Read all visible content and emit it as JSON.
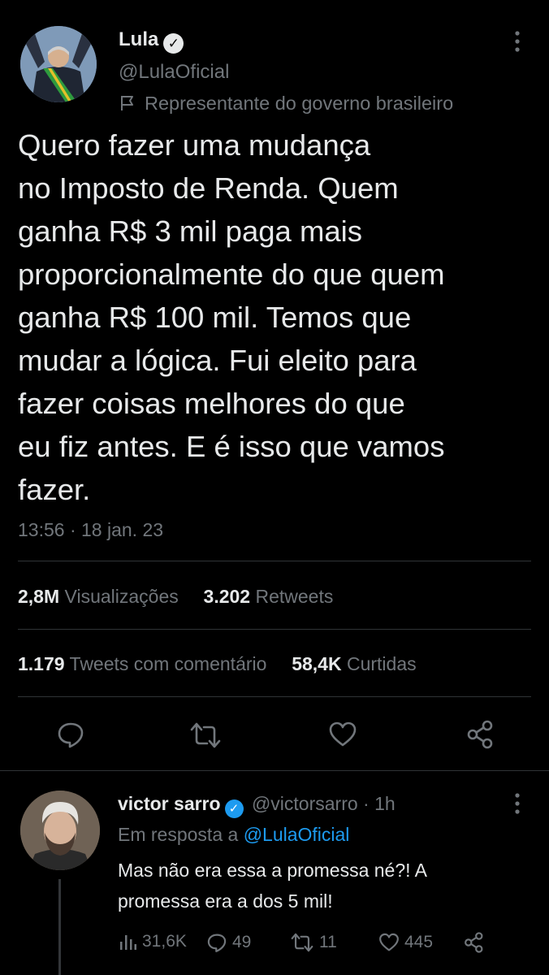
{
  "tweet": {
    "author_name": "Lula",
    "author_handle": "@LulaOficial",
    "gov_label": "Representante do governo brasileiro",
    "text": "Quero fazer uma mudança\nno Imposto de Renda. Quem\nganha R$ 3 mil paga mais\nproporcionalmente do que quem\nganha R$ 100 mil. Temos que\nmudar a lógica. Fui eleito para\nfazer coisas melhores do que\neu fiz antes. E é isso que vamos\nfazer.",
    "timestamp": "13:56 · 18 jan. 23",
    "stats": {
      "views_count": "2,8M",
      "views_label": "Visualizações",
      "retweets_count": "3.202",
      "retweets_label": "Retweets",
      "quotes_count": "1.179",
      "quotes_label": "Tweets com comentário",
      "likes_count": "58,4K",
      "likes_label": "Curtidas"
    }
  },
  "reply": {
    "author_name": "victor sarro",
    "author_handle": "@victorsarro",
    "time": "· 1h",
    "reply_prefix": "Em resposta a",
    "reply_to": "@LulaOficial",
    "text": "Mas não era essa a promessa né?! A\npromessa era a dos 5 mil!",
    "views": "31,6K",
    "replies": "49",
    "retweets": "11",
    "likes": "445"
  },
  "icons": {
    "verified": "verified-check-icon",
    "flag": "flag-icon",
    "more": "more-icon",
    "reply": "reply-icon",
    "retweet": "retweet-icon",
    "like": "heart-icon",
    "share": "share-icon",
    "views": "views-icon"
  },
  "colors": {
    "background": "#000000",
    "text": "#e7e9ea",
    "muted": "#71767b",
    "link": "#1d9bf0",
    "divider": "#2f3336"
  }
}
